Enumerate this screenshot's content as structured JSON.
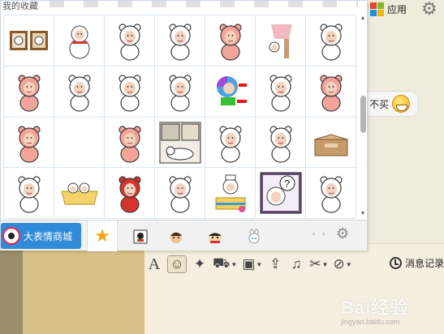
{
  "panel": {
    "title": "我的收藏",
    "emoji_grid": [
      [
        {
          "name": "sticker-bear-photo-frames",
          "kind": "frames"
        },
        {
          "name": "sticker-bear-snowman",
          "kind": "snowman"
        },
        {
          "name": "sticker-bear-standing",
          "kind": "bear",
          "color": "#ffffff"
        },
        {
          "name": "sticker-bear-hands-on-head",
          "kind": "bear",
          "color": "#ffffff"
        },
        {
          "name": "sticker-bear-pink-box",
          "kind": "bear",
          "color": "#f4a39b"
        },
        {
          "name": "sticker-bear-tree",
          "kind": "tree"
        },
        {
          "name": "sticker-bear-dancing",
          "kind": "bear",
          "color": "#ffffff"
        }
      ],
      [
        {
          "name": "sticker-bear-pink-hood",
          "kind": "bear",
          "color": "#f4a39b"
        },
        {
          "name": "sticker-bear-books",
          "kind": "bear",
          "color": "#ffffff"
        },
        {
          "name": "sticker-bear-brush",
          "kind": "bear",
          "color": "#ffffff"
        },
        {
          "name": "sticker-bear-sketch",
          "kind": "bear",
          "color": "#ffffff"
        },
        {
          "name": "sticker-bear-colorful",
          "kind": "color"
        },
        {
          "name": "sticker-bear-arms-up",
          "kind": "bear",
          "color": "#ffffff"
        },
        {
          "name": "sticker-bear-pink-wave",
          "kind": "bear",
          "color": "#f4a39b"
        }
      ],
      [
        {
          "name": "sticker-bear-pink-sit",
          "kind": "bear",
          "color": "#f4a39b"
        },
        {
          "name": "sticker-empty",
          "kind": "empty"
        },
        {
          "name": "sticker-bear-pink-hood-2",
          "kind": "bear",
          "color": "#f4a39b"
        },
        {
          "name": "sticker-bear-comic-panel",
          "kind": "comic"
        },
        {
          "name": "sticker-bear-rabbit-ears",
          "kind": "bear",
          "color": "#ffffff"
        },
        {
          "name": "sticker-bear-lying",
          "kind": "bear",
          "color": "#ffffff"
        },
        {
          "name": "sticker-box",
          "kind": "box"
        }
      ],
      [
        {
          "name": "sticker-bear-small",
          "kind": "bear",
          "color": "#ffffff"
        },
        {
          "name": "sticker-yellow-tub",
          "kind": "tub"
        },
        {
          "name": "sticker-bear-red-hood",
          "kind": "bear",
          "color": "#d8322d"
        },
        {
          "name": "sticker-bear-running",
          "kind": "bear",
          "color": "#ffffff"
        },
        {
          "name": "sticker-bear-cake",
          "kind": "cake"
        },
        {
          "name": "sticker-bear-question",
          "kind": "question"
        },
        {
          "name": "sticker-bear-peek",
          "kind": "bear",
          "color": "#ffffff"
        }
      ]
    ],
    "shop_label": "大表情商城",
    "pager_arrows": "‹ ›"
  },
  "window": {
    "apps_label": "应用",
    "chat_bubble_text": "不买",
    "history_label": "消息记录",
    "watermark_text": "Bai经验",
    "watermark_sub": "jingyan.baidu.com"
  },
  "toolbar_icons": [
    "font-icon",
    "smiley-icon",
    "magic-wand-icon",
    "car-icon",
    "screenshot-icon",
    "upload-icon",
    "music-icon",
    "scissors-icon",
    "image-block-icon"
  ],
  "colors": {
    "panel_border": "#c8d6e3",
    "shop_button": "#2f8ad8",
    "favorite_star": "#f3a614",
    "chat_background": "#f6efdf"
  }
}
